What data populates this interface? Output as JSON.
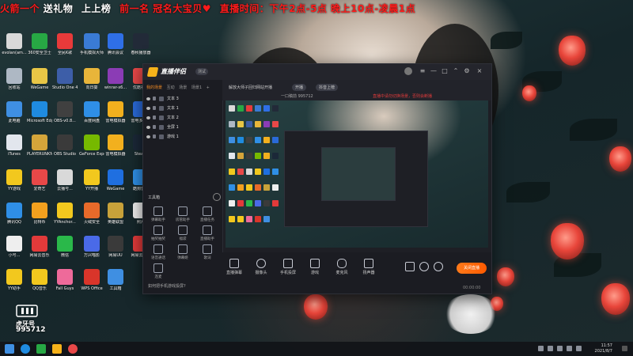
{
  "banner": {
    "part1": "火箭一个",
    "part2": "送礼物",
    "part3": "上上榜",
    "part4": "前一名 冠名大宝贝♥",
    "part5": "直播时间：下午2点-5点 晚上10点-凌晨1点"
  },
  "desktop_icons": [
    {
      "label": "evolan(am...",
      "color": "#d9d9d9"
    },
    {
      "label": "360安全卫士",
      "color": "#27a844"
    },
    {
      "label": "全民K歌",
      "color": "#e83a3a"
    },
    {
      "label": "手机模拟大师",
      "color": "#3a7bd5"
    },
    {
      "label": "腾讯会议",
      "color": "#2f6fe6"
    },
    {
      "label": "春秋播放器",
      "color": "#222a38"
    },
    {
      "label": "回收站",
      "color": "#aeb8c4"
    },
    {
      "label": "WeGame",
      "color": "#e8c646"
    },
    {
      "label": "Studio One 4",
      "color": "#3d5ea8"
    },
    {
      "label": "向日葵",
      "color": "#e8b53a"
    },
    {
      "label": "winrar-x6...",
      "color": "#8b3cb5"
    },
    {
      "label": "优酷视频",
      "color": "#e84848"
    },
    {
      "label": "此电脑",
      "color": "#3f8fe2"
    },
    {
      "label": "Microsoft Edge",
      "color": "#1f8be0"
    },
    {
      "label": "OBS-v0.8...",
      "color": "#404040"
    },
    {
      "label": "百度网盘",
      "color": "#2f8fe6"
    },
    {
      "label": "雷电模拟器",
      "color": "#f2b01e"
    },
    {
      "label": "雷电多开器",
      "color": "#2a6ad9"
    },
    {
      "label": "iTunes",
      "color": "#e2e6ed"
    },
    {
      "label": "PLAYERUNKNOWN'S BATTLEGR...",
      "color": "#d5a53a"
    },
    {
      "label": "OBS Studio",
      "color": "#3a3a3a"
    },
    {
      "label": "GeForce Experience",
      "color": "#76b900"
    },
    {
      "label": "雷电模拟器",
      "color": "#f2b01e"
    },
    {
      "label": "Steam",
      "color": "#1b2838"
    },
    {
      "label": "YY游戏",
      "color": "#f2c81e"
    },
    {
      "label": "爱奇艺",
      "color": "#e84848"
    },
    {
      "label": "云播号...",
      "color": "#d9d9d9"
    },
    {
      "label": "YY开播",
      "color": "#f2c81e"
    },
    {
      "label": "WeGame",
      "color": "#1f6fe0"
    },
    {
      "label": "酷狗音乐",
      "color": "#2f8fe6"
    },
    {
      "label": "腾讯QQ",
      "color": "#2f8fe6"
    },
    {
      "label": "比特币",
      "color": "#f2a01e"
    },
    {
      "label": "YYAnchor...",
      "color": "#f2c81e"
    },
    {
      "label": "火绒安全",
      "color": "#e86a2a"
    },
    {
      "label": "英雄联盟",
      "color": "#c8a23a"
    },
    {
      "label": "照片",
      "color": "#eeeeee"
    },
    {
      "label": "小号...",
      "color": "#eeeeee"
    },
    {
      "label": "网易云音乐",
      "color": "#e23a3a"
    },
    {
      "label": "微信",
      "color": "#2ab84a"
    },
    {
      "label": "万兴喵影",
      "color": "#4a6ae8"
    },
    {
      "label": "网易UU",
      "color": "#3a3a3a"
    },
    {
      "label": "网易云音乐",
      "color": "#e23a3a"
    },
    {
      "label": "YY助手",
      "color": "#f2c81e"
    },
    {
      "label": "QQ音乐",
      "color": "#f2c81e"
    },
    {
      "label": "Fall Guys",
      "color": "#ee6a9a"
    },
    {
      "label": "WPS Office",
      "color": "#d9352a"
    },
    {
      "label": "工具箱",
      "color": "#3f8fe2"
    }
  ],
  "app": {
    "title": "直播伴侣",
    "badge": "测试",
    "tabs": [
      "我的场景",
      "互动",
      "场景",
      "场景1"
    ],
    "sources": [
      "文本 3",
      "文本 1",
      "文本 2",
      "全屏 1",
      "游戏 1"
    ],
    "tools_title": "工具箱",
    "tools": [
      "弹幕助手",
      "房管助手",
      "直播任务",
      "抽奖抽奖",
      "福袋",
      "直播助手",
      "语音通话",
      "弹幕姬",
      "歌词",
      "连麦"
    ],
    "phone_text": "如何把手机游戏投屏?",
    "room_title": "解放大师子回归网站开播",
    "pill1": "开播",
    "pill2": "抖音上榜",
    "room_id": "一口稿前 995712",
    "warn": "直播中请勿切换场景，否则会断播",
    "controls": [
      "直播弹幕",
      "摄像头",
      "手机投屏",
      "游戏",
      "麦克风",
      "扬声器"
    ],
    "start_label": "关闭直播",
    "stream_time": "00:00:00"
  },
  "watermark": {
    "label": "虎牙号",
    "id": "995712"
  },
  "taskbar": {
    "time": "11:57",
    "date": "2021/8/7"
  }
}
